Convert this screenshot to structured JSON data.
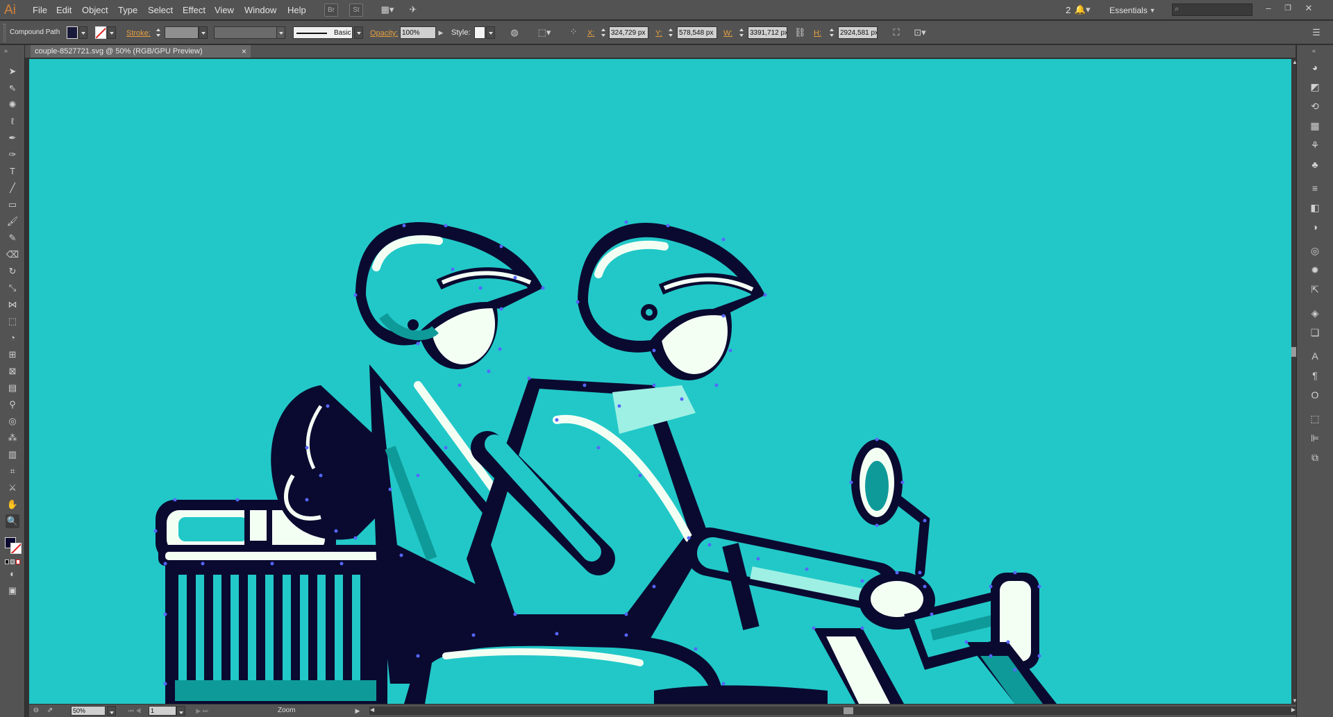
{
  "app": {
    "logo": "Ai"
  },
  "menu": [
    "File",
    "Edit",
    "Object",
    "Type",
    "Select",
    "Effect",
    "View",
    "Window",
    "Help"
  ],
  "menu_buttons": {
    "br": "Br",
    "st": "St"
  },
  "top_right": {
    "notifications": "2",
    "workspace": "Essentials"
  },
  "control_bar": {
    "selection_type": "Compound Path",
    "stroke_label": "Stroke:",
    "brush": "Basic",
    "opacity_label": "Opacity:",
    "opacity_value": "100%",
    "style_label": "Style:",
    "x_label": "X:",
    "x_value": "324,729 px",
    "y_label": "Y:",
    "y_value": "578,548 px",
    "w_label": "W:",
    "w_value": "3391,712 px",
    "h_label": "H:",
    "h_value": "2924,581 px",
    "fill_color": "#1a1a3a"
  },
  "document_tab": {
    "title": "couple-8527721.svg @ 50% (RGB/GPU Preview)",
    "close": "×"
  },
  "status_bar": {
    "zoom": "50%",
    "artboard": "1",
    "tool": "Zoom"
  },
  "colors": {
    "canvas": "#22c8c8",
    "ink": "#0a0a30",
    "cream": "#f4fff4",
    "teal_dark": "#0f9a9a",
    "teal_light": "#9ff0e4",
    "anchor": "#5566ff"
  }
}
